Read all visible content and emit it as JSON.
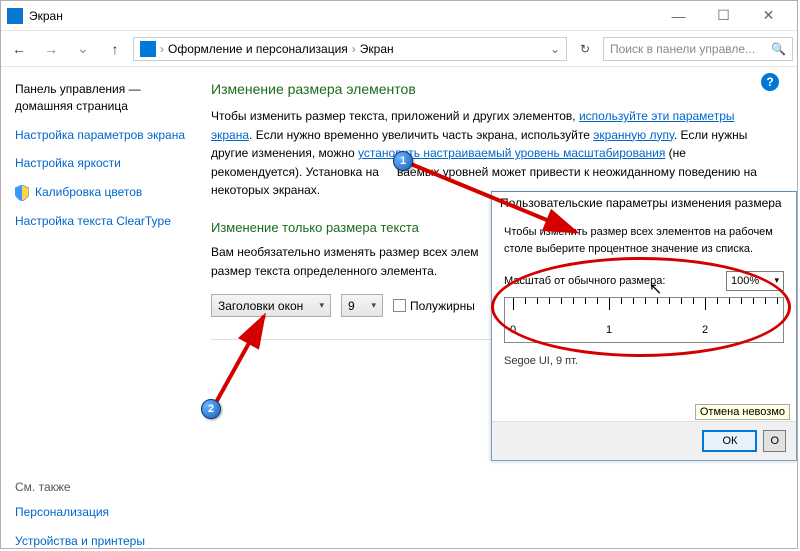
{
  "window": {
    "title": "Экран",
    "min": "—",
    "max": "☐",
    "close": "✕"
  },
  "nav": {
    "back": "←",
    "forward": "→",
    "up": "↑",
    "breadcrumb": {
      "lvl1": "Оформление и персонализация",
      "lvl2": "Экран",
      "sep": "›"
    },
    "refresh": "↻",
    "search_placeholder": "Поиск в панели управле...",
    "search_icon": "🔍"
  },
  "sidebar": {
    "home": "Панель управления — домашняя страница",
    "items": [
      "Настройка параметров экрана",
      "Настройка яркости",
      "Калибровка цветов",
      "Настройка текста ClearType"
    ],
    "seealso": "См. также",
    "seealso_items": [
      "Персонализация",
      "Устройства и принтеры"
    ]
  },
  "main": {
    "h1": "Изменение размера элементов",
    "p1a": "Чтобы изменить размер текста, приложений и других элементов, ",
    "p1link1": "используйте эти параметры экрана",
    "p1b": ". Если нужно временно увеличить часть экрана, используйте ",
    "p1link2": "экранную лупу",
    "p1c": ". Если нужны другие изменения, можно ",
    "p1link3": "установить настраиваемый уровень масштабирования",
    "p1d": " (не рекомендуется). Установка на",
    "p1e": "ваемых уровней может привести к неожиданному поведению на некоторых экранах.",
    "h2": "Изменение только размера текста",
    "p2": "Вам необязательно изменять размер всех элем",
    "p2b": "размер текста определенного элемента.",
    "dd1": "Заголовки окон",
    "dd2": "9",
    "bold": "Полужирны"
  },
  "dialog": {
    "title": "Пользовательские параметры изменения размера",
    "p": "Чтобы изменить размер всех элементов на рабочем столе выберите процентное значение из списка.",
    "scale_label": "Масштаб от обычного размера:",
    "scale_value": "100%",
    "ruler": {
      "t0": "0",
      "t1": "1",
      "t2": "2"
    },
    "font_preview": "Segoe UI, 9 пт.",
    "cancel_note": "Отмена невозмо",
    "ok": "ОК",
    "cancel": "О"
  },
  "help": "?",
  "annotations": {
    "m1": "1",
    "m2": "2"
  }
}
